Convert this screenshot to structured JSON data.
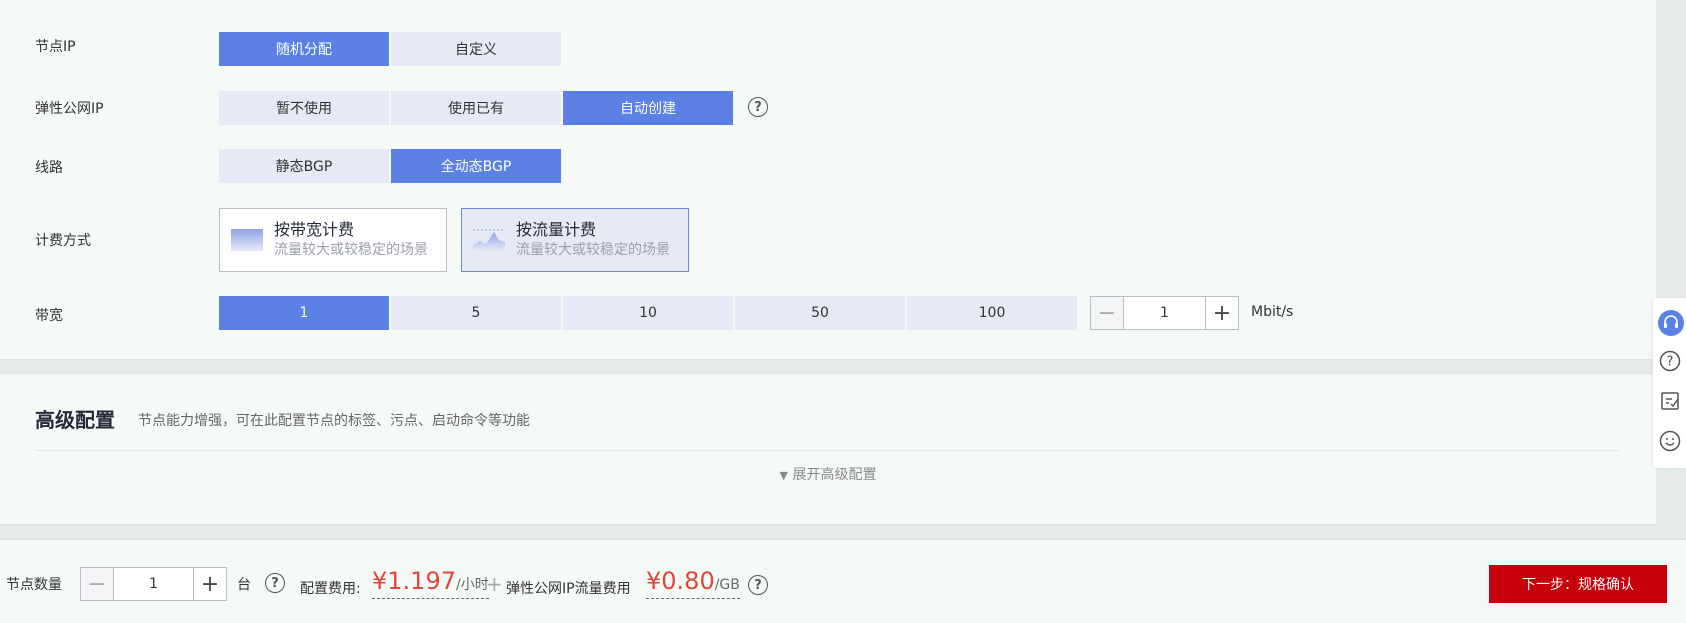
{
  "node_ip": {
    "label": "节点IP",
    "options": [
      "随机分配",
      "自定义"
    ],
    "selected": "随机分配"
  },
  "eip": {
    "label": "弹性公网IP",
    "options": [
      "暂不使用",
      "使用已有",
      "自动创建"
    ],
    "selected": "自动创建"
  },
  "line": {
    "label": "线路",
    "options": [
      "静态BGP",
      "全动态BGP"
    ],
    "selected": "全动态BGP"
  },
  "billing": {
    "label": "计费方式",
    "options": [
      {
        "title": "按带宽计费",
        "subtitle": "流量较大或较稳定的场景",
        "icon": "bandwidth-icon"
      },
      {
        "title": "按流量计费",
        "subtitle": "流量较大或较稳定的场景",
        "icon": "traffic-icon"
      }
    ],
    "selected": "按流量计费"
  },
  "bandwidth": {
    "label": "带宽",
    "options": [
      "1",
      "5",
      "10",
      "50",
      "100"
    ],
    "selected": "1",
    "value": "1",
    "unit": "Mbit/s"
  },
  "advanced": {
    "title": "高级配置",
    "description": "节点能力增强，可在此配置节点的标签、污点、启动命令等功能",
    "expand_label": "展开高级配置"
  },
  "footer": {
    "node_count_label": "节点数量",
    "node_count": "1",
    "node_unit": "台",
    "config_fee_label": "配置费用:",
    "config_fee": "¥1.197",
    "config_fee_unit": "/小时",
    "plus": "+",
    "eip_fee_label": "弹性公网IP流量费用",
    "eip_fee": "¥0.80",
    "eip_fee_unit": "/GB",
    "next_button": "下一步：规格确认"
  },
  "sidebar_icons": [
    "headset-icon",
    "help-icon",
    "feedback-icon",
    "smiley-icon"
  ],
  "colors": {
    "accent": "#5a81e3",
    "price": "#e0473b",
    "primary_button": "#c7000b"
  }
}
